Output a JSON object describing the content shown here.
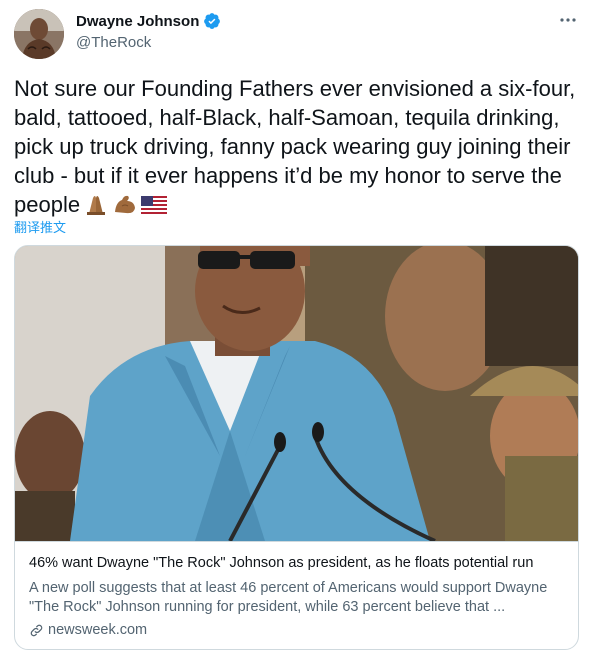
{
  "user": {
    "display_name": "Dwayne Johnson",
    "handle": "@TheRock",
    "verified": true
  },
  "tweet": {
    "text": "Not sure our Founding Fathers ever envisioned a six-four, bald, tattooed, half-Black, half-Samoan, tequila drinking, pick up truck driving, fanny pack wearing guy joining their club - but if it ever happens it’d be my honor to serve the people",
    "emojis": [
      "folded-hands",
      "flexed-biceps",
      "us-flag"
    ]
  },
  "translate_label": "翻译推文",
  "card": {
    "title": "46% want Dwayne \"The Rock\" Johnson as president, as he floats potential run",
    "description": "A new poll suggests that at least 46 percent of Americans would support Dwayne \"The Rock\" Johnson running for president, while 63 percent believe that ...",
    "domain": "newsweek.com"
  },
  "colors": {
    "accent": "#1d9bf0",
    "secondary_text": "#536471",
    "border": "#cfd9de",
    "jacket": "#5ea3c9"
  }
}
